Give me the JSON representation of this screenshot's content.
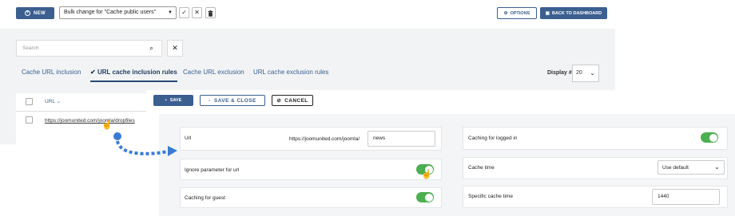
{
  "toolbar": {
    "new_label": "NEW",
    "bulk_action": "Bulk change for \"Cache public users\"",
    "options_label": "OPTIONS",
    "dashboard_label": "BACK TO DASHBOARD"
  },
  "search": {
    "placeholder": "Search"
  },
  "tabs": [
    {
      "label": "Cache URL inclusion"
    },
    {
      "label": "URL cache inclusion rules"
    },
    {
      "label": "Cache URL exclusion"
    },
    {
      "label": "URL cache exclusion rules"
    }
  ],
  "display": {
    "label": "Display #",
    "value": "20"
  },
  "list": {
    "column_header": "URL",
    "rows": [
      {
        "url": "https://joomunited.com/joomla/dropfiles"
      }
    ]
  },
  "actions": {
    "save_label": "SAVE",
    "save_close_label": "SAVE & CLOSE",
    "cancel_label": "CANCEL"
  },
  "form": {
    "url_label": "Url",
    "url_prefix": "https://joomunited.com/joomla/",
    "url_value": "news",
    "ignore_param_label": "Ignore parameter for url",
    "ignore_param_on": true,
    "guest_label": "Caching for guest",
    "guest_on": true,
    "logged_in_label": "Caching for logged in",
    "logged_in_on": true,
    "cache_time_label": "Cache time",
    "cache_time_value": "Use default",
    "specific_time_label": "Specific cache time",
    "specific_time_value": "1440"
  },
  "colors": {
    "primary": "#3b5f8f",
    "toggle_on": "#4caf50",
    "arrow": "#3a7bd5"
  }
}
